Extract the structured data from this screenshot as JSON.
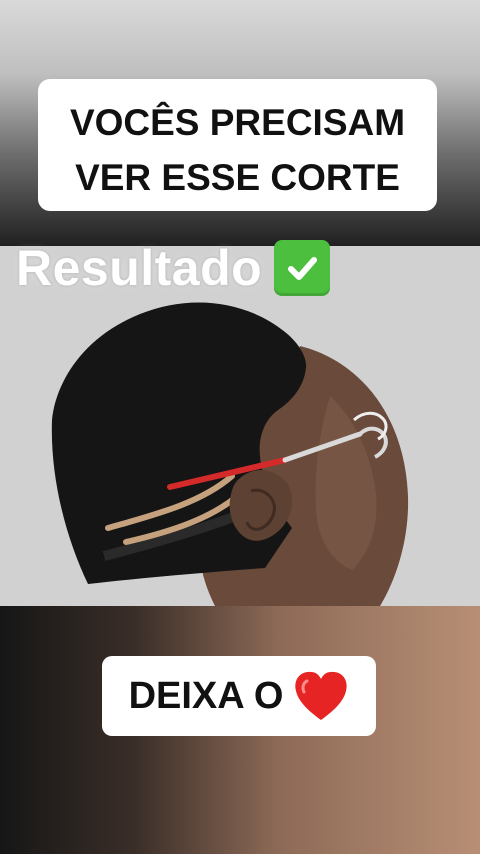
{
  "captions": {
    "top_line1": "VOCÊS PRECISAM",
    "top_line2": "VER ESSE CORTE",
    "bottom": "DEIXA O"
  },
  "photo": {
    "label": "Resultado",
    "label_icon": "check-mark-icon",
    "label_icon_color": "#4cbf3f"
  },
  "emoji": {
    "heart": "heart-icon",
    "heart_color": "#e62424"
  }
}
